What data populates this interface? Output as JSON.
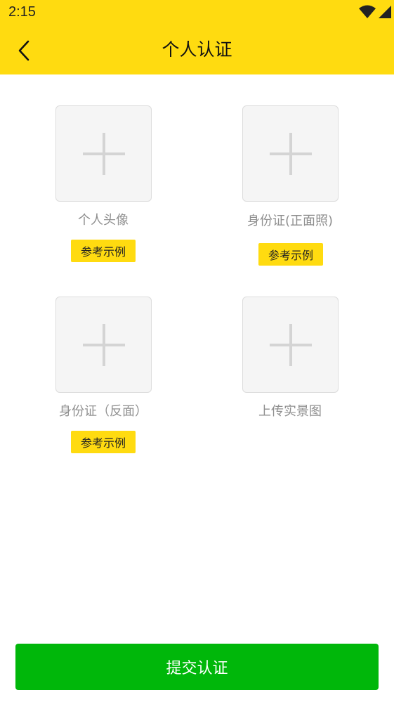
{
  "status_bar": {
    "time": "2:15",
    "icons": [
      "wifi-icon",
      "cellular-signal-icon",
      "battery-charging-icon"
    ]
  },
  "header": {
    "title": "个人认证",
    "back_icon": "back-chevron-icon",
    "background_color": "#FFDB10"
  },
  "uploads": [
    {
      "label": "个人头像",
      "example_label": "参考示例"
    },
    {
      "label": "身份证(正面照)",
      "example_label": "参考示例"
    },
    {
      "label": "身份证（反面）",
      "example_label": "参考示例"
    },
    {
      "label": "上传实景图"
    }
  ],
  "upload_icon": "plus-icon",
  "submit": {
    "label": "提交认证",
    "color": "#00B70A"
  }
}
